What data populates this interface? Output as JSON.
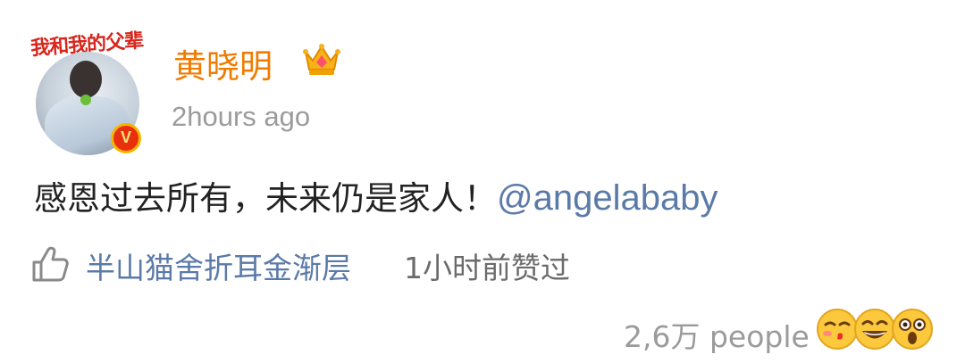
{
  "post": {
    "avatar_banner": "我和我的父辈",
    "verified_mark": "V",
    "username": "黄晓明",
    "timestamp": "2hours ago",
    "text": "感恩过去所有，未来仍是家人！",
    "mention": "@angelababy"
  },
  "likes": {
    "liker": "半山猫舍折耳金渐层",
    "time": "1小时前赞过"
  },
  "reactions": {
    "count_label": "2,6万 people",
    "emojis": [
      "kiss-emoji",
      "grin-emoji",
      "surprised-emoji"
    ]
  },
  "colors": {
    "username": "#f07b00",
    "link": "#5b7aa8",
    "muted": "#9b9b9b"
  }
}
